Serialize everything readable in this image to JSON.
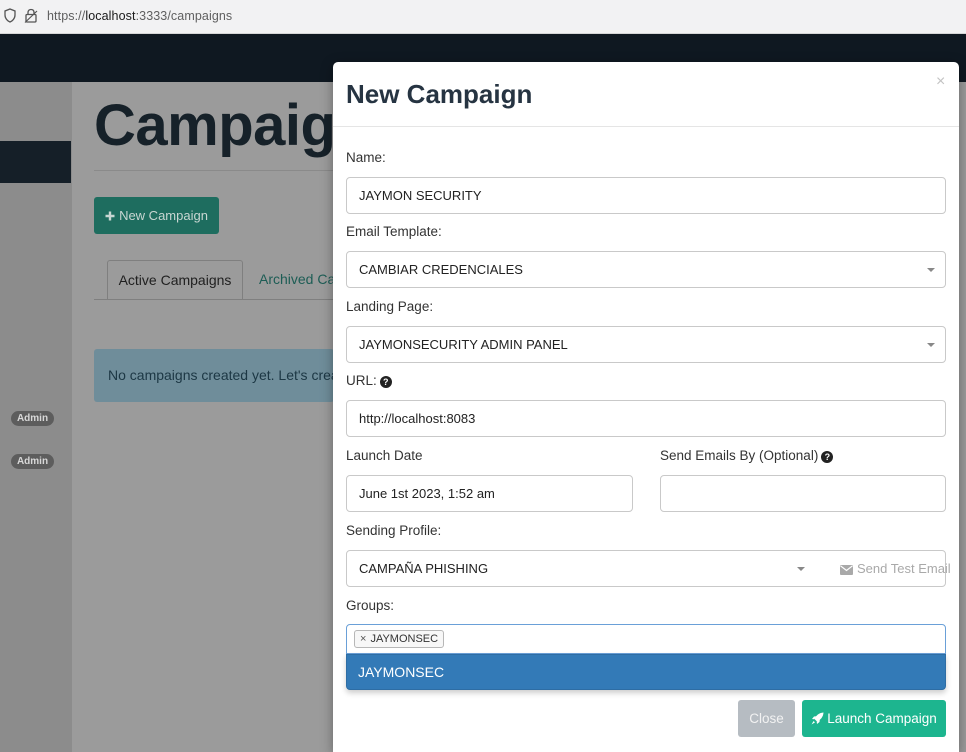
{
  "browser": {
    "url_prefix": "https://",
    "url_host": "localhost",
    "url_rest": ":3333/campaigns"
  },
  "page": {
    "title": "Campaigns",
    "new_campaign_label": "New Campaign",
    "tabs": [
      {
        "label": "Active Campaigns",
        "active": true
      },
      {
        "label": "Archived Campaigns",
        "active": false
      }
    ],
    "empty_message": "No campaigns created yet. Let's create one!",
    "badges": [
      "Admin",
      "Admin"
    ]
  },
  "modal": {
    "title": "New Campaign",
    "close_glyph": "×",
    "name_label": "Name:",
    "name_value": "JAYMON SECURITY",
    "template_label": "Email Template:",
    "template_value": "CAMBIAR CREDENCIALES",
    "landing_label": "Landing Page:",
    "landing_value": "JAYMONSECURITY ADMIN PANEL",
    "url_label": "URL:",
    "url_value": "http://localhost:8083",
    "launch_date_label": "Launch Date",
    "launch_date_value": "June 1st 2023, 1:52 am",
    "send_by_label": "Send Emails By (Optional)",
    "send_by_value": "",
    "profile_label": "Sending Profile:",
    "profile_value": "CAMPAÑA PHISHING",
    "send_test_label": "Send Test Email",
    "groups_label": "Groups:",
    "groups_selected": [
      "JAYMONSEC"
    ],
    "groups_option": "JAYMONSEC",
    "close_button": "Close",
    "launch_button": "Launch Campaign"
  },
  "colors": {
    "accent": "#1db58f",
    "primary_highlight": "#337ab7",
    "nav_dark": "#0f1821"
  }
}
